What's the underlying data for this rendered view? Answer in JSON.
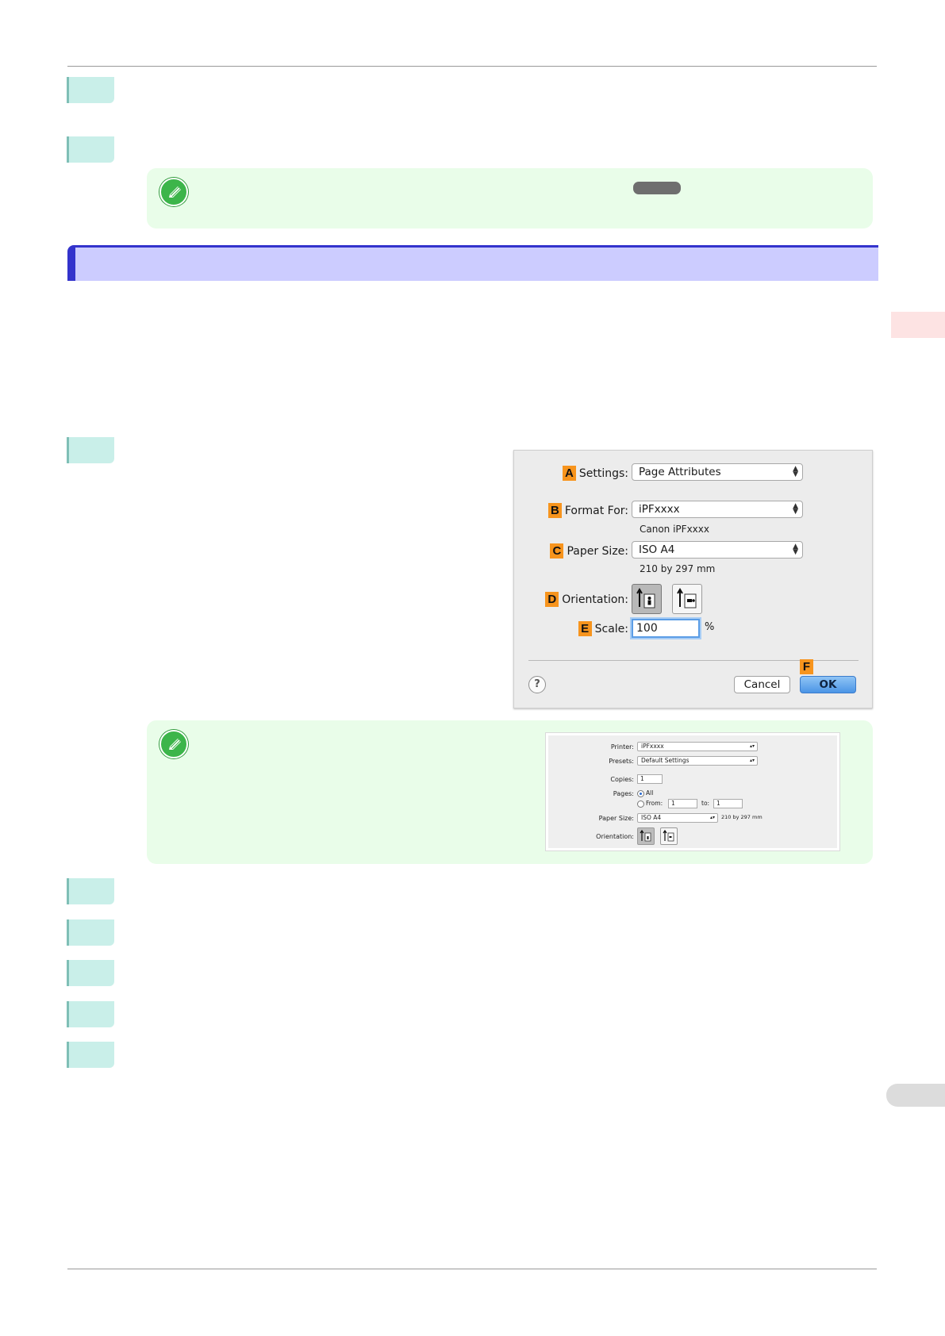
{
  "dialog": {
    "settings": {
      "badge": "A",
      "label": "Settings:",
      "value": "Page Attributes"
    },
    "format_for": {
      "badge": "B",
      "label": "Format For:",
      "value": "iPFxxxx",
      "sub": "Canon iPFxxxx"
    },
    "paper_size": {
      "badge": "C",
      "label": "Paper Size:",
      "value": "ISO A4",
      "sub": "210 by 297 mm"
    },
    "orientation": {
      "badge": "D",
      "label": "Orientation:"
    },
    "scale": {
      "badge": "E",
      "label": "Scale:",
      "value": "100",
      "unit": "%"
    },
    "ok_badge": "F",
    "help_label": "?",
    "cancel_label": "Cancel",
    "ok_label": "OK"
  },
  "print_dialog": {
    "printer": {
      "label": "Printer:",
      "value": "iPFxxxx"
    },
    "presets": {
      "label": "Presets:",
      "value": "Default Settings"
    },
    "copies": {
      "label": "Copies:",
      "value": "1"
    },
    "pages": {
      "label": "Pages:",
      "all_label": "All",
      "from_label": "From:",
      "from_value": "1",
      "to_label": "to:",
      "to_value": "1"
    },
    "paper_size": {
      "label": "Paper Size:",
      "value": "ISO A4",
      "dimensions": "210 by 297 mm"
    },
    "orientation": {
      "label": "Orientation:"
    }
  },
  "colors": {
    "step_tab": "#c9efe9",
    "note_background": "#e9fde9",
    "section_bar": "#ccccff",
    "section_accent": "#3333cc",
    "badge": "#f7941d",
    "ok_button": "#4b95e6"
  }
}
